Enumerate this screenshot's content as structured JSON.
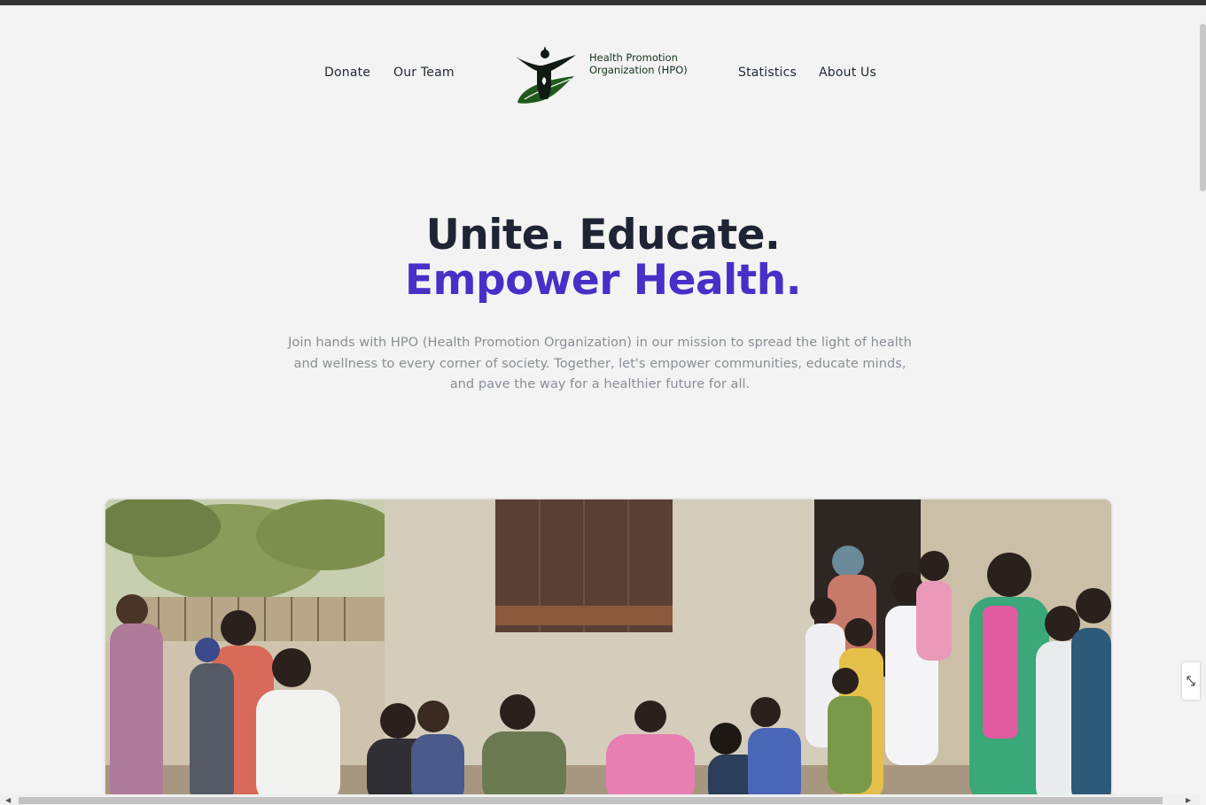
{
  "nav": {
    "left": [
      {
        "label": "Donate"
      },
      {
        "label": "Our Team"
      }
    ],
    "right": [
      {
        "label": "Statistics"
      },
      {
        "label": "About Us"
      }
    ],
    "logo": {
      "line1": "Health Promotion",
      "line2": "Organization (HPO)"
    }
  },
  "hero": {
    "line1": "Unite. Educate.",
    "line2": "Empower Health.",
    "description": "Join hands with HPO (Health Promotion Organization) in our mission to spread the light of health and wellness to every corner of society. Together, let's empower communities, educate minds, and pave the way for a healthier future for all."
  },
  "colors": {
    "heading": "#1e2434",
    "accent": "#4630c8",
    "body_text": "#8a8e97",
    "logo_green": "#1f5a1c"
  },
  "photo": {
    "icon": "community-photo"
  },
  "side_widget": {
    "icon": "expand-icon"
  }
}
